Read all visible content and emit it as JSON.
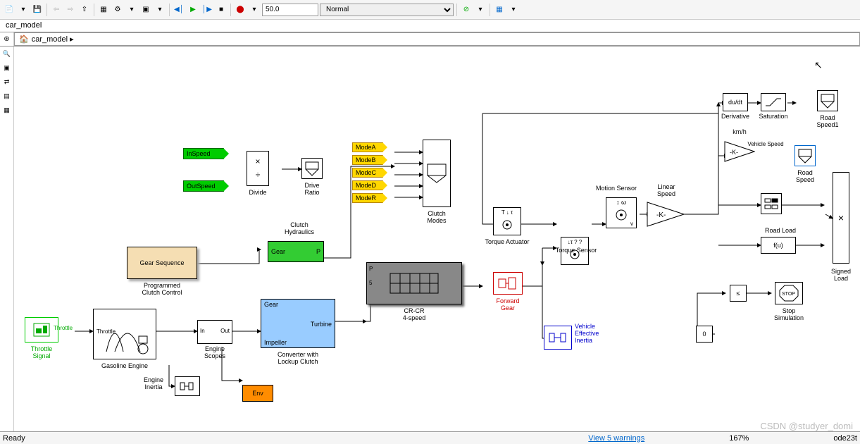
{
  "toolbar": {
    "stop_time": "50.0",
    "mode": "Normal"
  },
  "title": "car_model",
  "breadcrumb": "car_model ▸",
  "blocks": {
    "throttle_signal": {
      "label": "Throttle\nSignal",
      "port": "Throttle"
    },
    "gasoline_engine": {
      "label": "Gasoline Engine",
      "port_in": "Throttle"
    },
    "engine_inertia": {
      "label": "Engine\nInertia"
    },
    "engine_scopes": {
      "label": "Engine\nScopes",
      "in": "In",
      "out": "Out"
    },
    "env": {
      "label": "Env"
    },
    "programmed": {
      "label": "Programmed\nClutch Control",
      "box": "Gear Sequence"
    },
    "inspeed": "InSpeed",
    "outspeed": "OutSpeed",
    "divide": {
      "label": "Divide",
      "ops": "×\n÷"
    },
    "drive_ratio": "Drive\nRatio",
    "clutch_hydraulics": {
      "label": "Clutch\nHydraulics",
      "in": "Gear",
      "out": "P"
    },
    "converter": {
      "label": "Converter with\nLockup Clutch",
      "p1": "Gear",
      "p2": "Impeller",
      "p3": "Turbine"
    },
    "modes": {
      "a": "ModeA",
      "b": "ModeB",
      "c": "ModeC",
      "d": "ModeD",
      "r": "ModeR",
      "label": "Clutch\nModes"
    },
    "crcr": "CR-CR\n4-speed",
    "forward_gear": "Forward\nGear",
    "torque_actuator": "Torque Actuator",
    "torque_sensor": "Torque Sensor",
    "vehicle_inertia": "Vehicle\nEffective\nInertia",
    "motion_sensor": "Motion Sensor",
    "linear_speed": "Linear\nSpeed",
    "kmh": "km/h",
    "vehicle_speed": "Vehicle Speed",
    "road_speed": "Road\nSpeed",
    "road_load": {
      "label": "Road Load",
      "fn": "f(u)"
    },
    "signed_load": "Signed\nLoad",
    "derivative": {
      "label": "Derivative",
      "fn": "du/dt"
    },
    "saturation": "Saturation",
    "road_speed1": "Road\nSpeed1",
    "stop_sim": {
      "label": "Stop\nSimulation",
      "txt": "STOP"
    },
    "zero": "0",
    "gain_k1": "-K-",
    "gain_k2": "-K-"
  },
  "status": {
    "ready": "Ready",
    "warnings": "View 5 warnings",
    "zoom": "167%",
    "solver": "ode23t"
  },
  "watermark": "CSDN @studyer_domi"
}
